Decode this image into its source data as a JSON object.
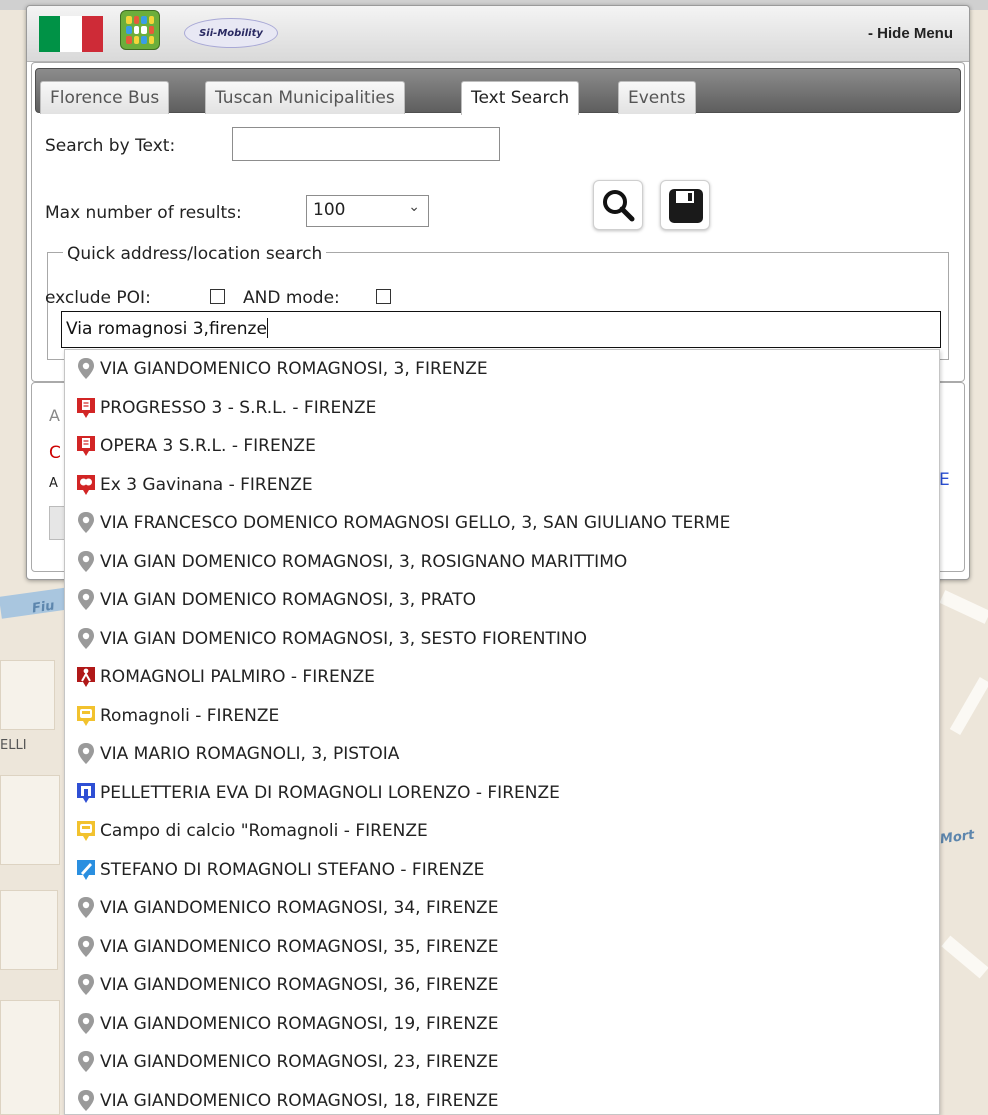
{
  "header": {
    "hide_menu_label": "- Hide Menu",
    "sii_logo_text": "Sii-Mobility",
    "km4city_logo_text": "KM4CITY"
  },
  "tabs": [
    {
      "label": "Florence Bus",
      "active": false
    },
    {
      "label": "Tuscan Municipalities",
      "active": false
    },
    {
      "label": "Text Search",
      "active": true
    },
    {
      "label": "Events",
      "active": false
    }
  ],
  "search": {
    "text_label": "Search by Text:",
    "text_value": "",
    "max_results_label": "Max number of results:",
    "max_results_value": "100"
  },
  "quick_search": {
    "legend": "Quick address/location search",
    "exclude_poi_label": "exclude POI:",
    "and_mode_label": "AND mode:",
    "input_value": "Via romagnosi 3,firenze"
  },
  "hidden_fragments": {
    "a_letter": "A",
    "red_c": "C",
    "a_small": "A",
    "e_right": "E"
  },
  "map_labels": {
    "river": "Fiu",
    "street_left": "ELLI",
    "street_right": "Mort"
  },
  "suggestions": [
    {
      "label": "VIA GIANDOMENICO ROMAGNOSI, 3, FIRENZE",
      "icon": "grey-location-pin-icon",
      "color": "#9a9a9a"
    },
    {
      "label": "PROGRESSO 3 - S.R.L. - FIRENZE",
      "icon": "red-document-icon",
      "color": "#d22525"
    },
    {
      "label": "OPERA 3 S.R.L. - FIRENZE",
      "icon": "red-document-icon",
      "color": "#d22525"
    },
    {
      "label": "Ex 3 Gavinana - FIRENZE",
      "icon": "red-theatre-masks-icon",
      "color": "#d22525"
    },
    {
      "label": "VIA FRANCESCO DOMENICO ROMAGNOSI GELLO, 3, SAN GIULIANO TERME",
      "icon": "grey-location-pin-icon",
      "color": "#9a9a9a"
    },
    {
      "label": "VIA GIAN DOMENICO ROMAGNOSI, 3, ROSIGNANO MARITTIMO",
      "icon": "grey-location-pin-icon",
      "color": "#9a9a9a"
    },
    {
      "label": "VIA GIAN DOMENICO ROMAGNOSI, 3, PRATO",
      "icon": "grey-location-pin-icon",
      "color": "#9a9a9a"
    },
    {
      "label": "VIA GIAN DOMENICO ROMAGNOSI, 3, SESTO FIORENTINO",
      "icon": "grey-location-pin-icon",
      "color": "#9a9a9a"
    },
    {
      "label": "ROMAGNOLI PALMIRO - FIRENZE",
      "icon": "dark-red-worker-icon",
      "color": "#b01818"
    },
    {
      "label": "Romagnoli - FIRENZE",
      "icon": "yellow-bus-icon",
      "color": "#f2c22e"
    },
    {
      "label": "VIA MARIO ROMAGNOLI, 3, PISTOIA",
      "icon": "grey-location-pin-icon",
      "color": "#9a9a9a"
    },
    {
      "label": "PELLETTERIA EVA DI ROMAGNOLI LORENZO - FIRENZE",
      "icon": "blue-shop-icon",
      "color": "#2f4fd4"
    },
    {
      "label": "Campo di calcio \"Romagnoli - FIRENZE",
      "icon": "yellow-bus-icon",
      "color": "#f2c22e"
    },
    {
      "label": "STEFANO DI ROMAGNOLI STEFANO - FIRENZE",
      "icon": "light-blue-pen-icon",
      "color": "#2a8fe0"
    },
    {
      "label": "VIA GIANDOMENICO ROMAGNOSI, 34, FIRENZE",
      "icon": "grey-location-pin-icon",
      "color": "#9a9a9a"
    },
    {
      "label": "VIA GIANDOMENICO ROMAGNOSI, 35, FIRENZE",
      "icon": "grey-location-pin-icon",
      "color": "#9a9a9a"
    },
    {
      "label": "VIA GIANDOMENICO ROMAGNOSI, 36, FIRENZE",
      "icon": "grey-location-pin-icon",
      "color": "#9a9a9a"
    },
    {
      "label": "VIA GIANDOMENICO ROMAGNOSI, 19, FIRENZE",
      "icon": "grey-location-pin-icon",
      "color": "#9a9a9a"
    },
    {
      "label": "VIA GIANDOMENICO ROMAGNOSI, 23, FIRENZE",
      "icon": "grey-location-pin-icon",
      "color": "#9a9a9a"
    },
    {
      "label": "VIA GIANDOMENICO ROMAGNOSI, 18, FIRENZE",
      "icon": "grey-location-pin-icon",
      "color": "#9a9a9a"
    }
  ],
  "colors": {
    "flag_green": "#009246",
    "flag_white": "#ffffff",
    "flag_red": "#ce2b37",
    "tab_strip": "#6e6e6e"
  }
}
